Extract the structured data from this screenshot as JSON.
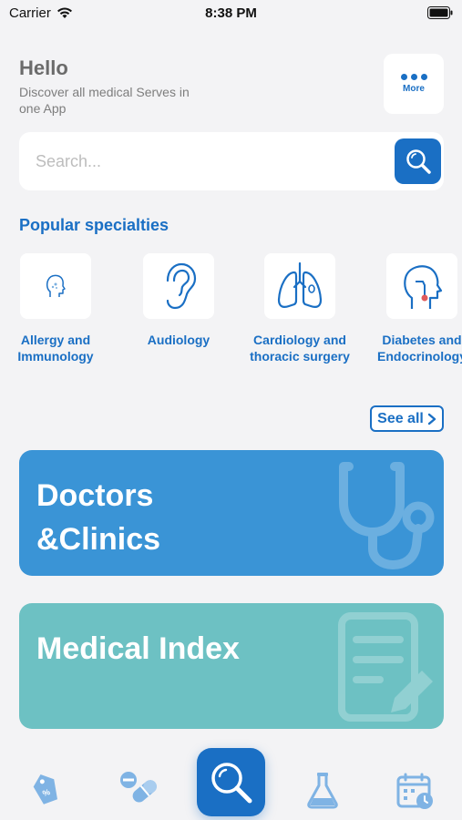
{
  "status_bar": {
    "carrier": "Carrier",
    "time": "8:38 PM"
  },
  "header": {
    "greeting": "Hello",
    "subtitle": "Discover all medical Serves in one App",
    "more_label": "More"
  },
  "search": {
    "placeholder": "Search..."
  },
  "specialties": {
    "title": "Popular specialties",
    "items": [
      {
        "label": "Allergy and Immunology",
        "icon": "head-allergy-icon"
      },
      {
        "label": "Audiology",
        "icon": "ear-icon"
      },
      {
        "label": "Cardiology and thoracic surgery",
        "icon": "lungs-icon"
      },
      {
        "label": "Diabetes and Endocrinology",
        "icon": "head-throat-icon"
      }
    ],
    "see_all": "See all"
  },
  "cards": {
    "doctors": "Doctors &Clinics",
    "medical_index": "Medical Index"
  },
  "colors": {
    "accent": "#1a6fc4",
    "doctors_card": "#3a94d6",
    "medical_card": "#6dc1c3",
    "background": "#f3f3f5"
  }
}
